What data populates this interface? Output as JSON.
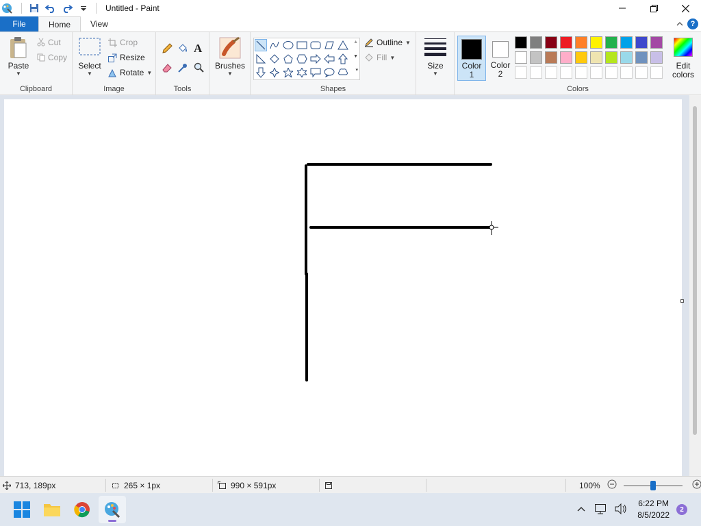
{
  "window": {
    "title": "Untitled - Paint"
  },
  "tabs": [
    {
      "label": "File"
    },
    {
      "label": "Home"
    },
    {
      "label": "View"
    }
  ],
  "clipboard": {
    "group": "Clipboard",
    "paste": "Paste",
    "cut": "Cut",
    "copy": "Copy"
  },
  "image": {
    "group": "Image",
    "select": "Select",
    "crop": "Crop",
    "resize": "Resize",
    "rotate": "Rotate"
  },
  "tools": {
    "group": "Tools"
  },
  "brushes": {
    "label": "Brushes"
  },
  "shapes": {
    "group": "Shapes",
    "outline": "Outline",
    "fill": "Fill",
    "selected": "line-icon"
  },
  "size": {
    "label": "Size"
  },
  "colors": {
    "group": "Colors",
    "color1": "Color\n1",
    "color1_a": "Color",
    "color1_b": "1",
    "color2_a": "Color",
    "color2_b": "2",
    "edit_a": "Edit",
    "edit_b": "colors",
    "color1_value": "#000000",
    "color2_value": "#ffffff",
    "palette_row1": [
      "#000000",
      "#7f7f7f",
      "#880015",
      "#ed1c24",
      "#ff7f27",
      "#fff200",
      "#22b14c",
      "#00a2e8",
      "#3f48cc",
      "#a349a4"
    ],
    "palette_row2": [
      "#ffffff",
      "#c3c3c3",
      "#b97a57",
      "#ffaec9",
      "#ffc90e",
      "#efe4b0",
      "#b5e61d",
      "#99d9ea",
      "#7092be",
      "#c8bfe7"
    ],
    "palette_row3": [
      "#ffffff",
      "#ffffff",
      "#ffffff",
      "#ffffff",
      "#ffffff",
      "#ffffff",
      "#ffffff",
      "#ffffff",
      "#ffffff",
      "#ffffff"
    ]
  },
  "status": {
    "cursor_pos": "713, 189px",
    "selection_size": "265 × 1px",
    "canvas_size": "990 × 591px",
    "zoom": "100%",
    "zoom_fraction": 0.5
  },
  "taskbar": {
    "time": "6:22 PM",
    "date": "8/5/2022",
    "notifications": "2"
  }
}
